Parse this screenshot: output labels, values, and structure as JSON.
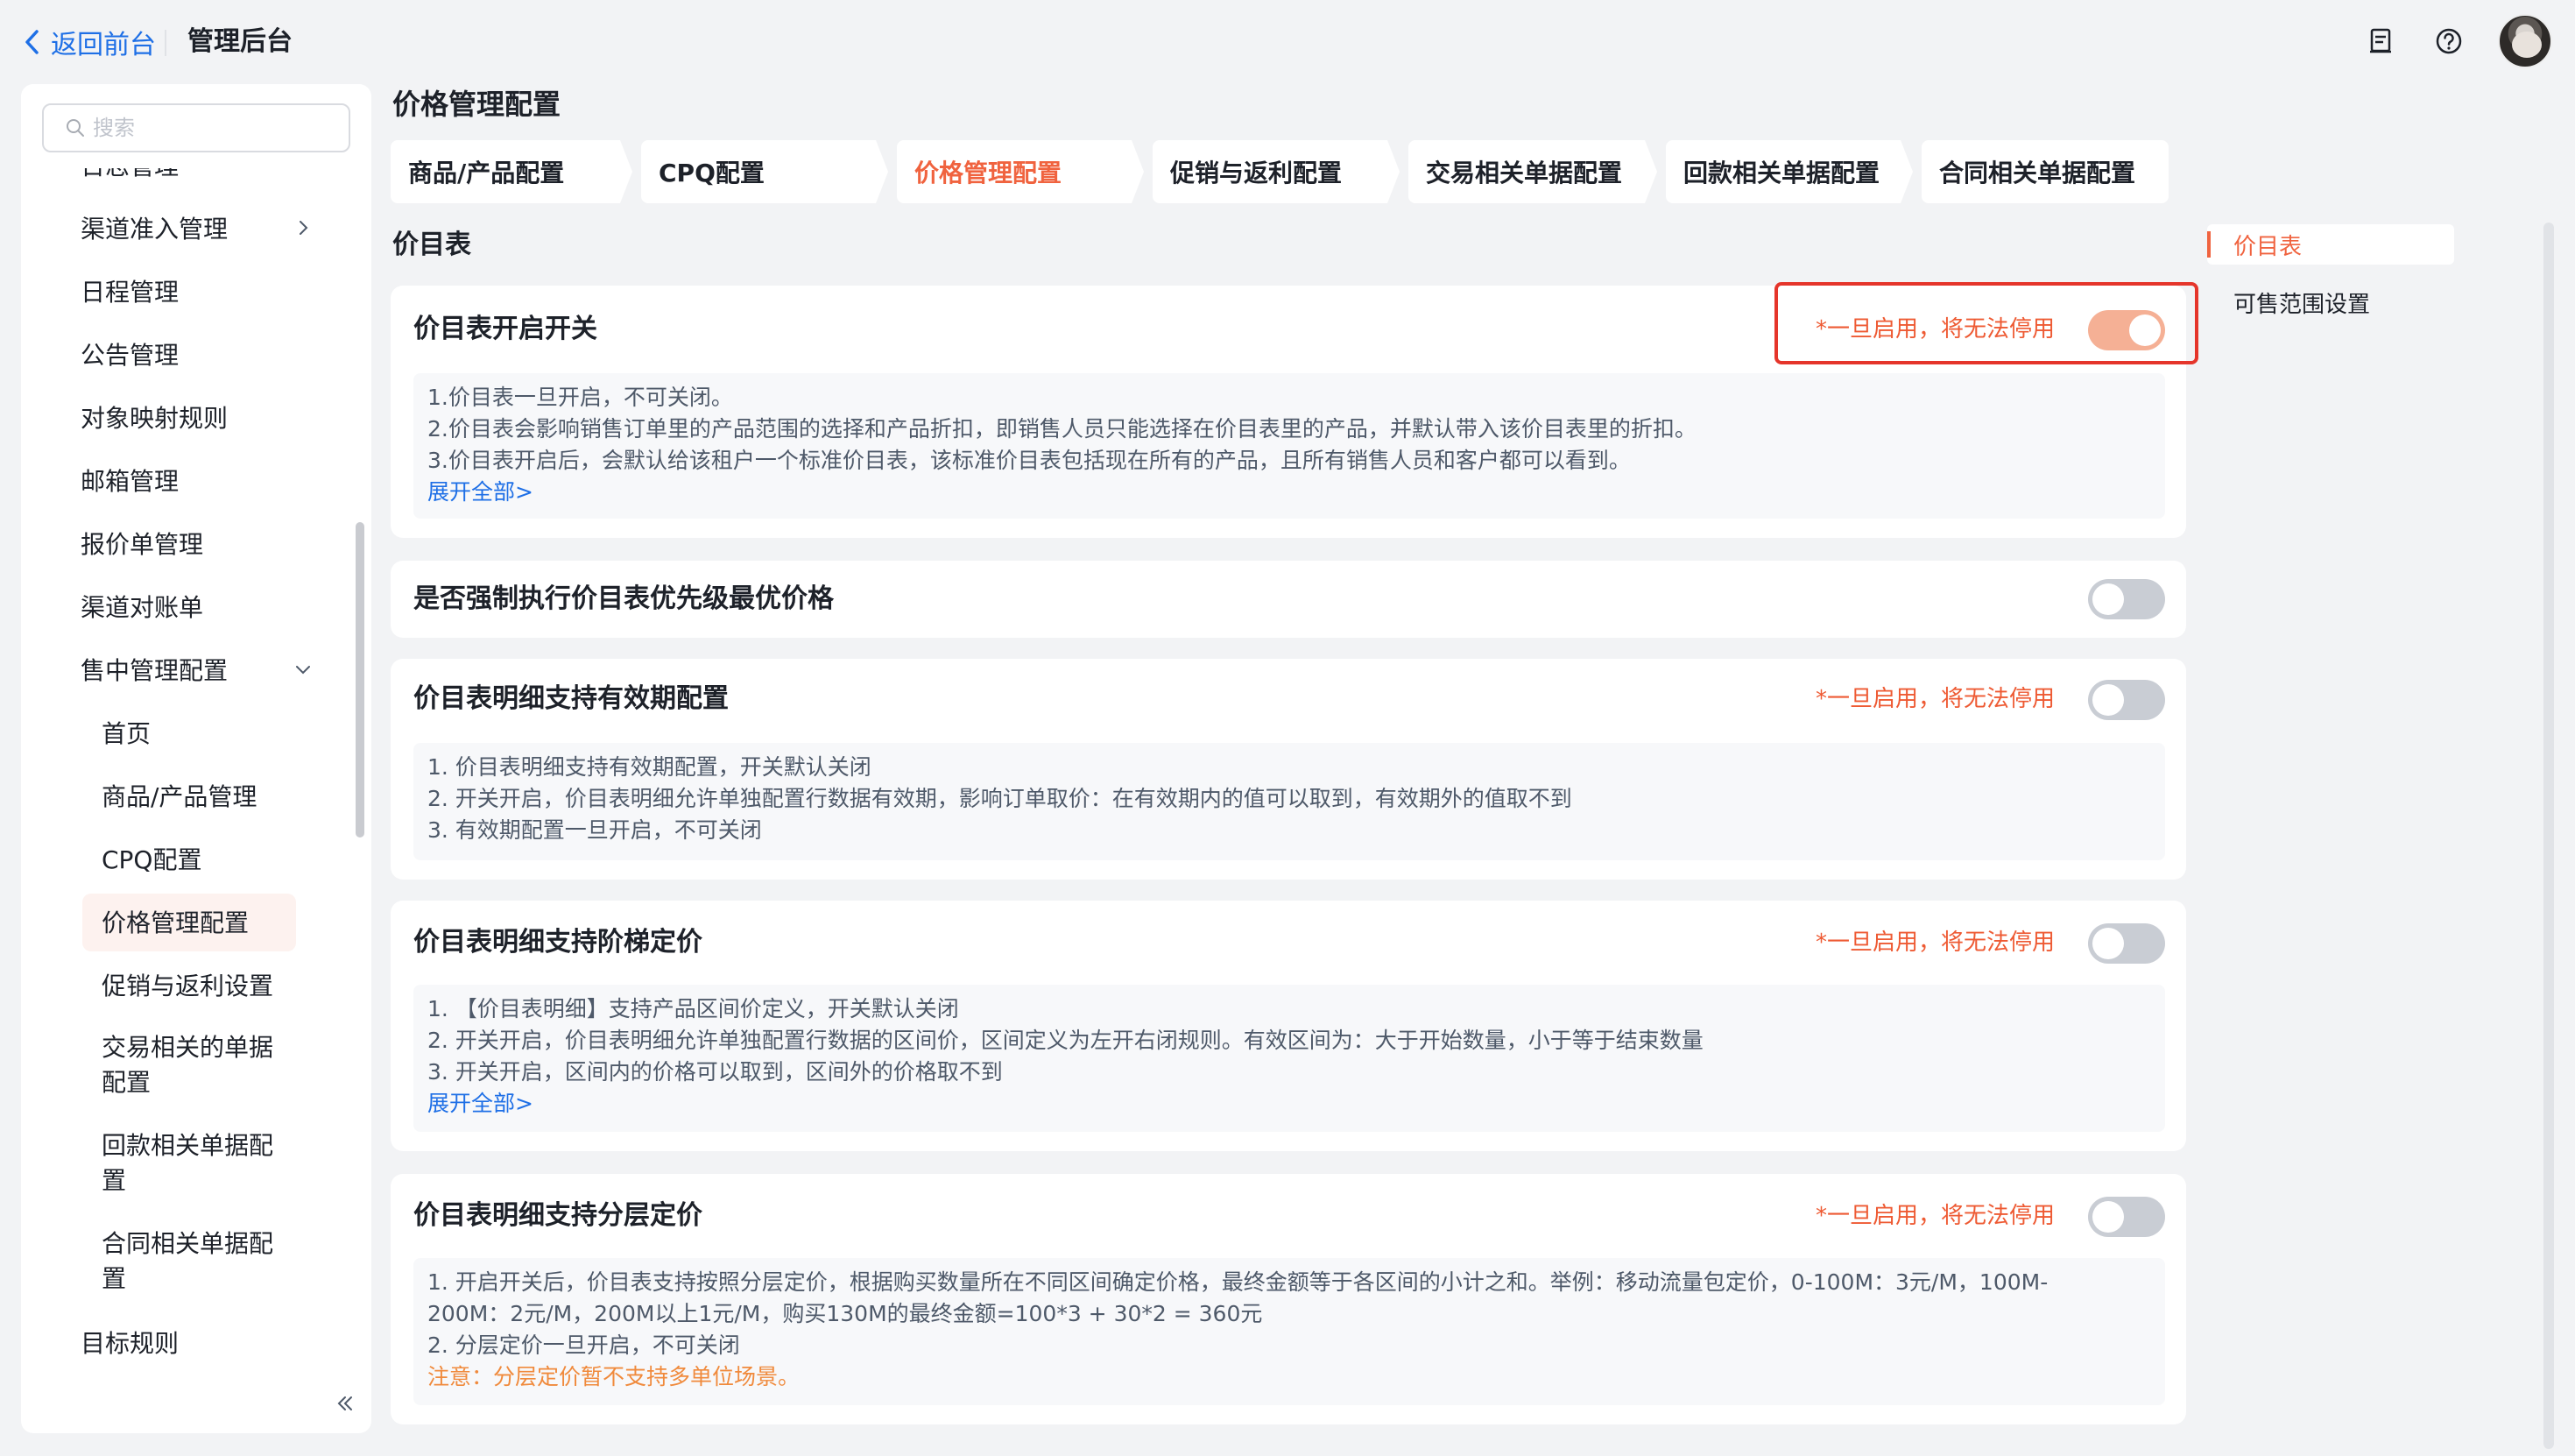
{
  "topbar": {
    "back_label": "返回前台",
    "app_title": "管理后台",
    "icons": [
      "document-icon",
      "help-icon"
    ]
  },
  "sidebar": {
    "search_placeholder": "搜索",
    "items": [
      {
        "label": "日志管理",
        "level": 1
      },
      {
        "label": "渠道准入管理",
        "level": 1,
        "chevron": "right"
      },
      {
        "label": "日程管理",
        "level": 1
      },
      {
        "label": "公告管理",
        "level": 1
      },
      {
        "label": "对象映射规则",
        "level": 1
      },
      {
        "label": "邮箱管理",
        "level": 1
      },
      {
        "label": "报价单管理",
        "level": 1
      },
      {
        "label": "渠道对账单",
        "level": 1
      },
      {
        "label": "售中管理配置",
        "level": 1,
        "chevron": "down"
      },
      {
        "label": "首页",
        "level": 2
      },
      {
        "label": "商品/产品管理",
        "level": 2
      },
      {
        "label": "CPQ配置",
        "level": 2
      },
      {
        "label": "价格管理配置",
        "level": 2,
        "active": true
      },
      {
        "label": "促销与返利设置",
        "level": 2
      },
      {
        "label": "交易相关的单据配置",
        "level": 2
      },
      {
        "label": "回款相关单据配置",
        "level": 2
      },
      {
        "label": "合同相关单据配置",
        "level": 2
      },
      {
        "label": "目标规则",
        "level": 1
      }
    ]
  },
  "main": {
    "page_title": "价格管理配置",
    "tabs": [
      {
        "label": "商品/产品配置"
      },
      {
        "label": "CPQ配置"
      },
      {
        "label": "价格管理配置",
        "active": true
      },
      {
        "label": "促销与返利配置"
      },
      {
        "label": "交易相关单据配置"
      },
      {
        "label": "回款相关单据配置"
      },
      {
        "label": "合同相关单据配置"
      }
    ],
    "section_title": "价目表",
    "cards": [
      {
        "title": "价目表开启开关",
        "warning": "*一旦启用，将无法停用",
        "enabled": true,
        "lines": [
          "1.价目表一旦开启，不可关闭。",
          "2.价目表会影响销售订单里的产品范围的选择和产品折扣，即销售人员只能选择在价目表里的产品，并默认带入该价目表里的折扣。",
          "3.价目表开启后，会默认给该租户一个标准价目表，该标准价目表包括现在所有的产品，且所有销售人员和客户都可以看到。"
        ],
        "expand": "展开全部>"
      },
      {
        "title": "是否强制执行价目表优先级最优价格",
        "enabled": false
      },
      {
        "title": "价目表明细支持有效期配置",
        "warning": "*一旦启用，将无法停用",
        "enabled": false,
        "lines": [
          "1. 价目表明细支持有效期配置，开关默认关闭",
          "2. 开关开启，价目表明细允许单独配置行数据有效期，影响订单取价：在有效期内的值可以取到，有效期外的值取不到",
          "3. 有效期配置一旦开启，不可关闭"
        ]
      },
      {
        "title": "价目表明细支持阶梯定价",
        "warning": "*一旦启用，将无法停用",
        "enabled": false,
        "lines": [
          "1. 【价目表明细】支持产品区间价定义，开关默认关闭",
          "2. 开关开启，价目表明细允许单独配置行数据的区间价，区间定义为左开右闭规则。有效区间为：大于开始数量，小于等于结束数量",
          "3. 开关开启，区间内的价格可以取到，区间外的价格取不到"
        ],
        "expand": "展开全部>"
      },
      {
        "title": "价目表明细支持分层定价",
        "warning": "*一旦启用，将无法停用",
        "enabled": false,
        "lines": [
          "1. 开启开关后，价目表支持按照分层定价，根据购买数量所在不同区间确定价格，最终金额等于各区间的小计之和。举例：移动流量包定价，0-100M：3元/M，100M-",
          "200M：2元/M，200M以上1元/M，购买130M的最终金额=100*3 + 30*2 = 360元",
          "2. 分层定价一旦开启，不可关闭"
        ],
        "note": "注意：分层定价暂不支持多单位场景。"
      }
    ]
  },
  "anchor_nav": {
    "items": [
      {
        "label": "价目表",
        "active": true
      },
      {
        "label": "可售范围设置"
      }
    ]
  },
  "colors": {
    "accent": "#f0633f",
    "link": "#1e6fe6",
    "warning": "#ee5a33",
    "toggle_on": "#f5b095",
    "highlight_border": "#e5352b"
  }
}
